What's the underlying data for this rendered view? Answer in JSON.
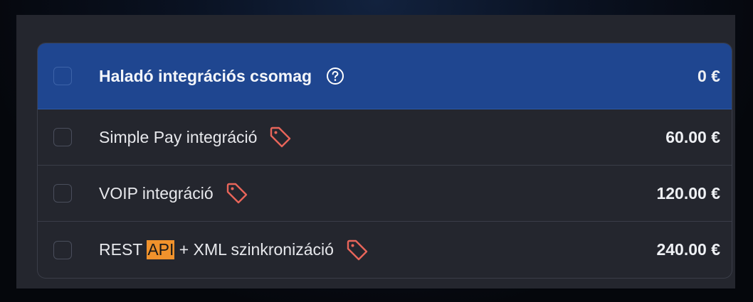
{
  "package": {
    "title": "Haladó integrációs csomag",
    "price": "0 €",
    "checked": false
  },
  "items": [
    {
      "label_before": "Simple Pay integráció",
      "highlight": "",
      "label_after": "",
      "price": "60.00 €",
      "checked": false,
      "icon": "tag-icon"
    },
    {
      "label_before": "VOIP integráció",
      "highlight": "",
      "label_after": "",
      "price": "120.00 €",
      "checked": false,
      "icon": "tag-icon"
    },
    {
      "label_before": "REST ",
      "highlight": "API",
      "label_after": " + XML szinkronizáció",
      "price": "240.00 €",
      "checked": false,
      "icon": "tag-icon"
    }
  ],
  "colors": {
    "header_bg": "#1f4690",
    "tag_icon": "#e8655a",
    "highlight": "#f0922c"
  }
}
